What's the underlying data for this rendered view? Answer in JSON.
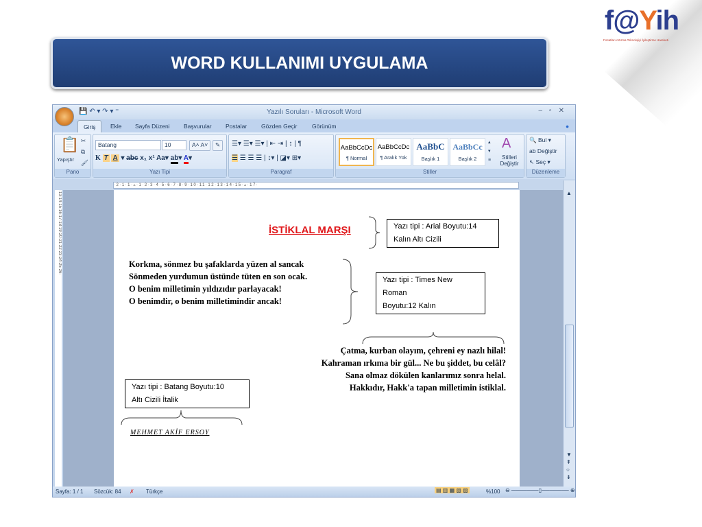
{
  "slide": {
    "title": "WORD KULLANIMI UYGULAMA",
    "logo_text": "f@tih",
    "logo_sub": "Fırsatları Artırma Teknolojiyi İyileştirme Hareketi"
  },
  "word": {
    "window_title": "Yazılı Soruları - Microsoft Word",
    "tabs": [
      "Giriş",
      "Ekle",
      "Sayfa Düzeni",
      "Başvurular",
      "Postalar",
      "Gözden Geçir",
      "Görünüm"
    ],
    "groups": {
      "pano": "Pano",
      "yazi_tipi": "Yazı Tipi",
      "paragraf": "Paragraf",
      "stiller": "Stiller",
      "duzenleme": "Düzenleme"
    },
    "paste_label": "Yapıştır",
    "font_name": "Batang",
    "font_size": "10",
    "styles": [
      {
        "sample": "AaBbCcDc",
        "name": "¶ Normal"
      },
      {
        "sample": "AaBbCcDc",
        "name": "¶ Aralık Yok"
      },
      {
        "sample": "AaBbC",
        "name": "Başlık 1"
      },
      {
        "sample": "AaBbCc",
        "name": "Başlık 2"
      }
    ],
    "change_styles": "Stilleri Değiştir",
    "editing": {
      "find": "Bul",
      "replace": "Değiştir",
      "select": "Seç"
    },
    "status": {
      "page": "Sayfa: 1 / 1",
      "words": "Sözcük: 84",
      "language": "Türkçe",
      "zoom": "%100"
    }
  },
  "document": {
    "heading": "İSTİKLAL MARŞI",
    "stanza1": [
      "Korkma, sönmez bu şafaklarda yüzen al sancak",
      "Sönmeden yurdumun üstünde tüten en son ocak.",
      "O benim milletimin yıldızıdır parlayacak!",
      "O benimdir, o benim milletimindir ancak!"
    ],
    "stanza2": [
      "Çatma, kurban olayım, çehreni ey nazlı hilal!",
      "Kahraman ırkıma bir gül... Ne bu şiddet, bu celâl?",
      "Sana olmaz dökülen kanlarımız sonra helal.",
      "Hakkıdır, Hakk'a tapan milletimin istiklal."
    ],
    "author": "MEHMET AKİF ERSOY",
    "note1": {
      "line1": "Yazı tipi : Arial  Boyutu:14",
      "line2": "Kalın      Altı Cizili"
    },
    "note2": {
      "line1": "Yazı tipi : Times New",
      "line2": "Roman",
      "line3": "Boyutu:12          Kalın"
    },
    "note3": {
      "line1": "Yazı tipi : Batang  Boyutu:10",
      "line2": "Altı Cizili     İtalik"
    }
  }
}
